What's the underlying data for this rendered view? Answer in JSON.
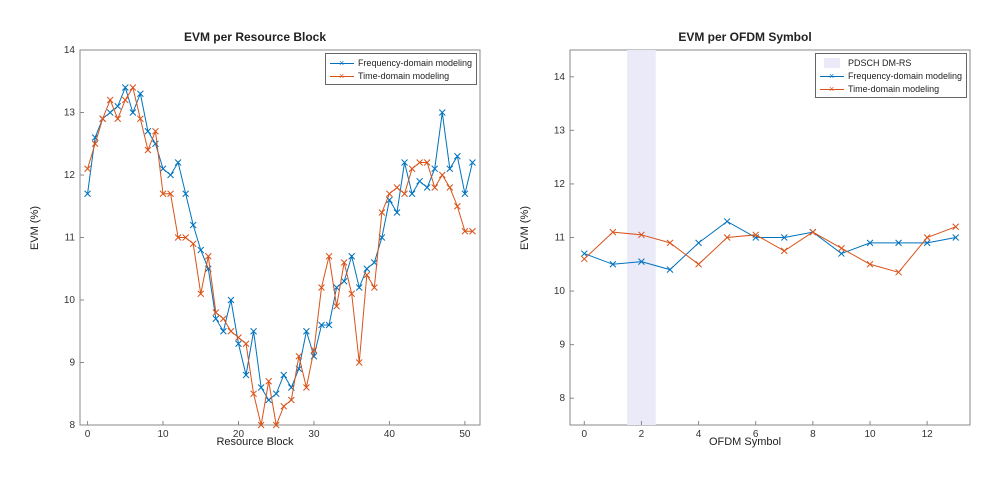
{
  "chart_data": [
    {
      "type": "line",
      "title": "EVM per Resource Block",
      "xlabel": "Resource Block",
      "ylabel": "EVM (%)",
      "xlim": [
        -1,
        52
      ],
      "ylim": [
        8,
        14
      ],
      "xticks": [
        0,
        10,
        20,
        30,
        40,
        50
      ],
      "yticks": [
        8,
        9,
        10,
        11,
        12,
        13,
        14
      ],
      "legend": {
        "position": "top-right",
        "entries": [
          "Frequency-domain modeling",
          "Time-domain modeling"
        ]
      },
      "x": [
        0,
        1,
        2,
        3,
        4,
        5,
        6,
        7,
        8,
        9,
        10,
        11,
        12,
        13,
        14,
        15,
        16,
        17,
        18,
        19,
        20,
        21,
        22,
        23,
        24,
        25,
        26,
        27,
        28,
        29,
        30,
        31,
        32,
        33,
        34,
        35,
        36,
        37,
        38,
        39,
        40,
        41,
        42,
        43,
        44,
        45,
        46,
        47,
        48,
        49,
        50,
        51
      ],
      "series": [
        {
          "name": "Frequency-domain modeling",
          "color": "#0072BD",
          "values": [
            11.7,
            12.6,
            12.9,
            13.0,
            13.1,
            13.4,
            13.0,
            13.3,
            12.7,
            12.5,
            12.1,
            12.0,
            12.2,
            11.7,
            11.2,
            10.8,
            10.5,
            9.7,
            9.5,
            10.0,
            9.3,
            8.8,
            9.5,
            8.6,
            8.4,
            8.5,
            8.8,
            8.6,
            8.9,
            9.5,
            9.1,
            9.6,
            9.6,
            10.2,
            10.3,
            10.7,
            10.2,
            10.5,
            10.6,
            11.0,
            11.6,
            11.4,
            12.2,
            11.7,
            11.9,
            11.8,
            12.1,
            13.0,
            12.1,
            12.3,
            11.7,
            12.2
          ]
        },
        {
          "name": "Time-domain modeling",
          "color": "#D95319",
          "values": [
            12.1,
            12.5,
            12.9,
            13.2,
            12.9,
            13.2,
            13.4,
            12.9,
            12.4,
            12.7,
            11.7,
            11.7,
            11.0,
            11.0,
            10.9,
            10.1,
            10.7,
            9.8,
            9.7,
            9.5,
            9.4,
            9.3,
            8.5,
            8.0,
            8.7,
            8.0,
            8.3,
            8.4,
            9.1,
            8.6,
            9.2,
            10.2,
            10.7,
            9.9,
            10.6,
            10.1,
            9.0,
            10.4,
            10.2,
            11.4,
            11.7,
            11.8,
            11.7,
            12.1,
            12.2,
            12.2,
            11.8,
            12.0,
            11.8,
            11.5,
            11.1,
            11.1
          ]
        }
      ]
    },
    {
      "type": "line",
      "title": "EVM per OFDM Symbol",
      "xlabel": "OFDM Symbol",
      "ylabel": "EVM (%)",
      "xlim": [
        -0.5,
        13.5
      ],
      "ylim": [
        7.5,
        14.5
      ],
      "xticks": [
        0,
        2,
        4,
        6,
        8,
        10,
        12
      ],
      "yticks": [
        8,
        9,
        10,
        11,
        12,
        13,
        14
      ],
      "patch": {
        "label": "PDSCH DM-RS",
        "x0": 1.5,
        "x1": 2.5
      },
      "legend": {
        "position": "top-right",
        "entries": [
          "PDSCH DM-RS",
          "Frequency-domain modeling",
          "Time-domain modeling"
        ]
      },
      "x": [
        0,
        1,
        2,
        3,
        4,
        5,
        6,
        7,
        8,
        9,
        10,
        11,
        12,
        13
      ],
      "series": [
        {
          "name": "Frequency-domain modeling",
          "color": "#0072BD",
          "values": [
            10.7,
            10.5,
            10.55,
            10.4,
            10.9,
            11.3,
            11.0,
            11.0,
            11.1,
            10.7,
            10.9,
            10.9,
            10.9,
            11.0
          ]
        },
        {
          "name": "Time-domain modeling",
          "color": "#D95319",
          "values": [
            10.6,
            11.1,
            11.05,
            10.9,
            10.5,
            11.0,
            11.05,
            10.75,
            11.1,
            10.8,
            10.5,
            10.35,
            11.0,
            11.2
          ]
        }
      ]
    }
  ]
}
